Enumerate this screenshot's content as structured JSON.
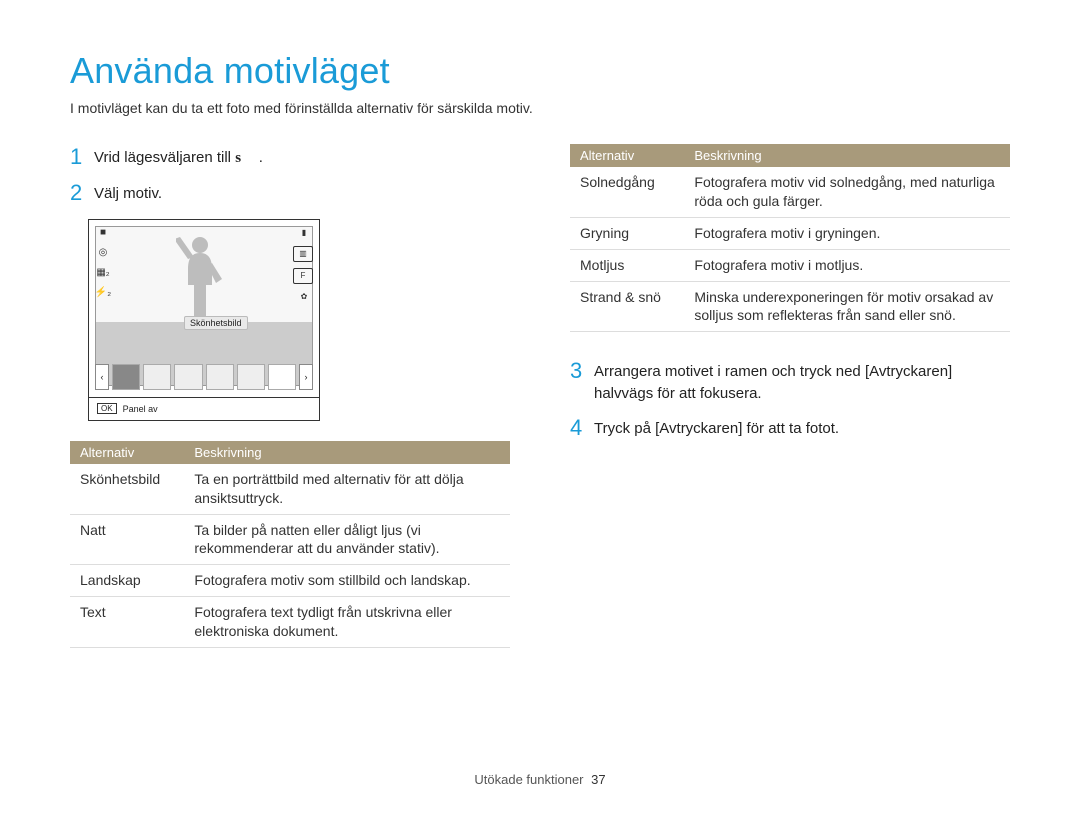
{
  "title": "Använda motivläget",
  "subtitle": "I motivläget kan du ta ett foto med förinställda alternativ för särskilda motiv.",
  "steps": {
    "s1": {
      "num": "1",
      "text_a": "Vrid lägesväljaren till ",
      "mode": "s",
      "text_b": "."
    },
    "s2": {
      "num": "2",
      "text": "Välj motiv."
    },
    "s3": {
      "num": "3",
      "text": "Arrangera motivet i ramen och tryck ned [Avtryckaren] halvvägs för att fokusera."
    },
    "s4": {
      "num": "4",
      "text": "Tryck på [Avtryckaren] för att ta fotot."
    }
  },
  "preview": {
    "label_bubble": "Skönhetsbild",
    "ok_label": "OK",
    "panel_label": "Panel av",
    "left_icons": [
      "■",
      "◎",
      "▦₂",
      "⚡₂"
    ],
    "right_icons": [
      "▮",
      "▥",
      "F",
      "✿"
    ]
  },
  "table_left": {
    "header": {
      "c1": "Alternativ",
      "c2": "Beskrivning"
    },
    "rows": [
      {
        "c1": "Skönhetsbild",
        "c2": "Ta en porträttbild med alternativ för att dölja ansiktsuttryck."
      },
      {
        "c1": "Natt",
        "c2": "Ta bilder på natten eller dåligt ljus (vi rekommenderar att du använder stativ)."
      },
      {
        "c1": "Landskap",
        "c2": "Fotografera motiv som stillbild och landskap."
      },
      {
        "c1": "Text",
        "c2": "Fotografera text tydligt från utskrivna eller elektroniska dokument."
      }
    ]
  },
  "table_right": {
    "header": {
      "c1": "Alternativ",
      "c2": "Beskrivning"
    },
    "rows": [
      {
        "c1": "Solnedgång",
        "c2": "Fotografera motiv vid solnedgång, med naturliga röda och gula färger."
      },
      {
        "c1": "Gryning",
        "c2": "Fotografera motiv i gryningen."
      },
      {
        "c1": "Motljus",
        "c2": "Fotografera motiv i motljus."
      },
      {
        "c1": "Strand & snö",
        "c2": "Minska underexponeringen för motiv orsakad av solljus som reflekteras från sand eller snö."
      }
    ]
  },
  "footer": {
    "label": "Utökade funktioner",
    "page": "37"
  }
}
